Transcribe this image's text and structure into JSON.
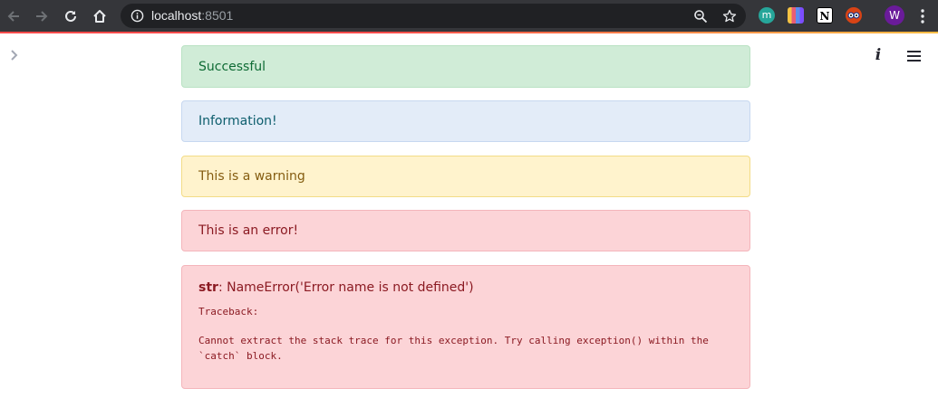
{
  "browser": {
    "url_host": "localhost",
    "url_port": ":8501",
    "profile_initial": "W",
    "ext_m_initial": "m",
    "ext_notion_initial": "N"
  },
  "colors": {
    "chrome_bg": "#35363a",
    "omnibox_bg": "#202124",
    "accent_start": "#ff4b4b",
    "accent_end": "#ffbd45",
    "profile_avatar": "#6a1b9a",
    "success_bg": "#d0ecd7",
    "info_bg": "#e3ecf8",
    "warning_bg": "#fff3cd",
    "error_bg": "#fcd4d7"
  },
  "icons": {
    "back": "arrow-left-icon",
    "forward": "arrow-right-icon",
    "reload": "reload-icon",
    "home": "home-icon",
    "site_info": "info-circle-icon",
    "zoom": "magnifier-icon",
    "bookmark": "star-icon",
    "browser_menu": "kebab-menu-icon",
    "sidebar_toggle": "chevron-right-icon",
    "app_info": "italic-i-icon",
    "app_menu": "hamburger-icon"
  },
  "alerts": {
    "success": "Successful",
    "info": "Information!",
    "warning": "This is a warning",
    "error": "This is an error!"
  },
  "exception": {
    "type_label": "str",
    "message": ": NameError('Error name is not defined')",
    "traceback_label": "Traceback:",
    "trace_line1": "Cannot extract the stack trace for this exception. Try calling exception() within the",
    "trace_line2": "`catch` block."
  },
  "app": {
    "info_glyph": "i"
  }
}
